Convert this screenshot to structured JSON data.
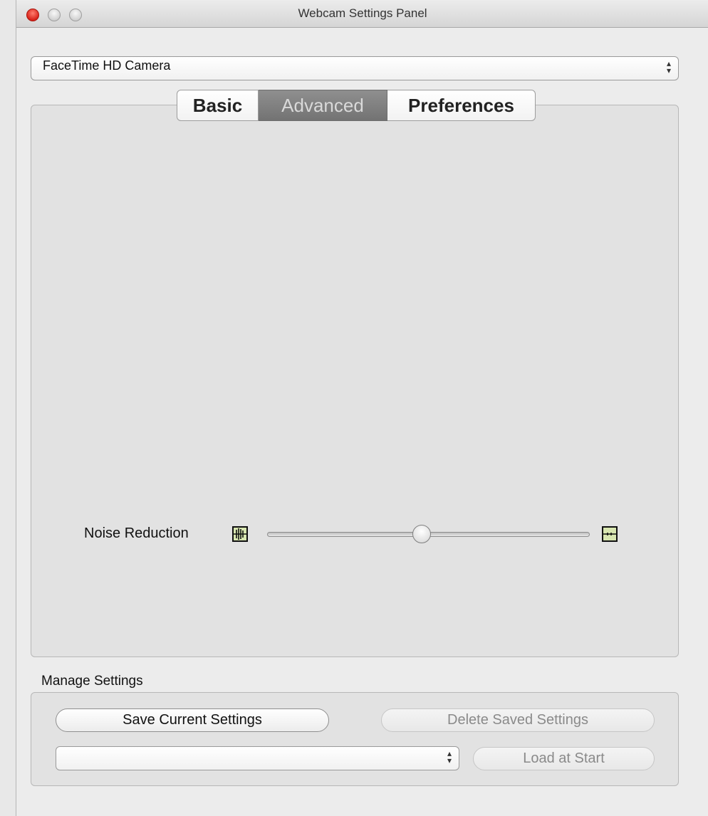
{
  "window": {
    "title": "Webcam Settings Panel"
  },
  "camera_select": {
    "value": "FaceTime HD Camera",
    "arrows_icon": "up-down-arrows-icon"
  },
  "tabs": [
    {
      "label": "Basic",
      "active": false
    },
    {
      "label": "Advanced",
      "active": true
    },
    {
      "label": "Preferences",
      "active": false
    }
  ],
  "noise_reduction": {
    "label": "Noise Reduction",
    "min_icon": "noise-high-icon",
    "max_icon": "noise-low-icon",
    "value_fraction": 0.48
  },
  "manage": {
    "section_label": "Manage Settings",
    "save_button": "Save Current Settings",
    "delete_button": "Delete Saved Settings",
    "saved_select_value": "",
    "load_at_start_button": "Load at Start"
  },
  "colors": {
    "close_button": "#d8231a",
    "active_tab": "#808080",
    "icon_fill": "#d8e6b0"
  }
}
